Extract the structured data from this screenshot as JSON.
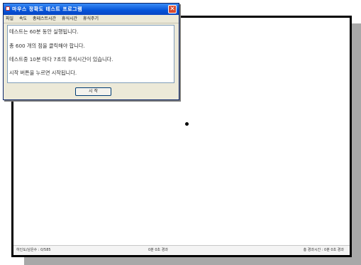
{
  "dialog": {
    "title": "마우스 정확도 테스트 프로그램",
    "close_label": "✕",
    "menu": [
      "파일",
      "속도",
      "총테스트시간",
      "휴식시간",
      "휴식주기"
    ],
    "lines": [
      "테스트는 60분 동안 실행됩니다.",
      "총 600 개의 점을 클릭해야 합니다.",
      "테스트중 10분 마다 7초의 휴식시간이 있습니다.",
      "시작 버튼을 누르면 시작됩니다."
    ],
    "start_label": "시 작"
  },
  "statusbar": {
    "left": "하인도/남은수 : 0/585",
    "middle": "0분 0초 경과",
    "right": "총 경과시간 : 0분 0초 경과"
  },
  "colors": {
    "title_bar": "#0553d8",
    "close_button": "#d84a2e",
    "dialog_bg": "#ece9d8"
  }
}
